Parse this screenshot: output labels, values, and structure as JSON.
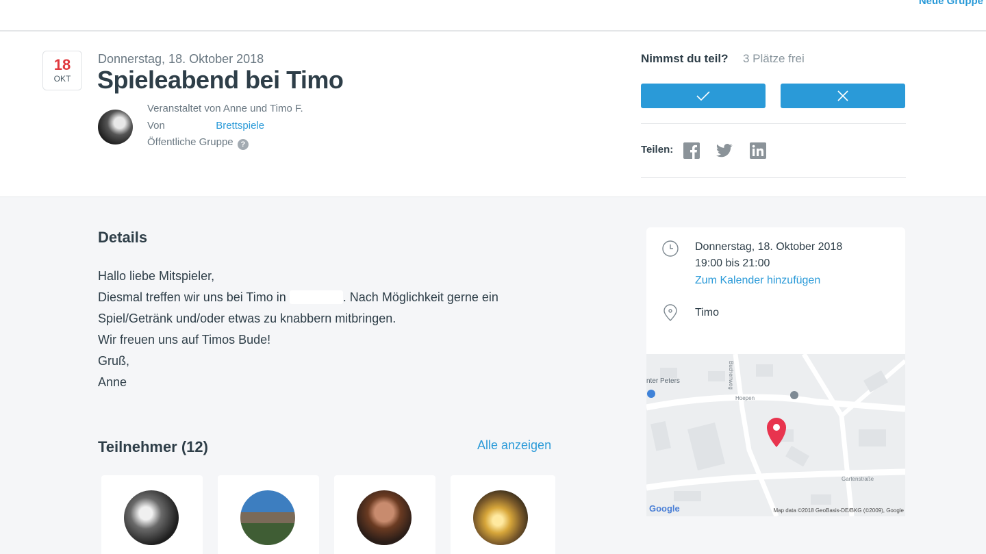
{
  "topbar": {
    "new_group": "Neue Gruppe"
  },
  "event": {
    "day": "18",
    "month": "OKT",
    "date_text": "Donnerstag, 18. Oktober 2018",
    "title": "Spieleabend bei Timo",
    "organized_by": "Veranstaltet von Anne und Timo F.",
    "from_prefix": "Von",
    "group_link": "Brettspiele",
    "group_type": "Öffentliche Gruppe",
    "help_glyph": "?"
  },
  "rsvp": {
    "question": "Nimmst du teil?",
    "spots": "3 Plätze frei",
    "yes_icon": "check-icon",
    "no_icon": "close-icon",
    "accent": "#2a9ad8"
  },
  "share": {
    "label": "Teilen:",
    "icons": [
      "facebook-icon",
      "twitter-icon",
      "linkedin-icon"
    ]
  },
  "details": {
    "heading": "Details",
    "lines": [
      "Hallo liebe Mitspieler,",
      "Diesmal treffen wir uns bei Timo in",
      ". Nach Möglichkeit gerne ein",
      "Spiel/Getränk und/oder etwas zu knabbern mitbringen.",
      "Wir freuen uns auf Timos Bude!",
      "Gruß,",
      "Anne"
    ]
  },
  "participants": {
    "heading": "Teilnehmer (12)",
    "show_all": "Alle anzeigen"
  },
  "info": {
    "date": "Donnerstag, 18. Oktober 2018",
    "time": "19:00 bis 21:00",
    "calendar_link": "Zum Kalender hinzufügen",
    "location": "Timo"
  },
  "map": {
    "poi_label": "nter Peters",
    "street_1": "Buchenweg",
    "street_2": "Hoepen",
    "street_3": "Gartenstraße",
    "google": "Google",
    "attribution": "Map data ©2018 GeoBasis-DE/BKG (©2009), Google",
    "pin_color": "#e8344e"
  }
}
